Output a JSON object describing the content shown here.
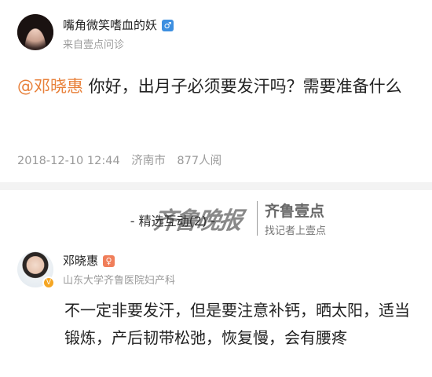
{
  "question": {
    "user_name": "嘴角微笑嗜血的妖",
    "gender_symbol": "♂",
    "source": "来自壹点问诊",
    "mention": "@邓晓惠",
    "text": " 你好，出月子必须要发汗吗？需要准备什么",
    "date": "2018-12-10 12:44",
    "location": "济南市",
    "views": "877人阅"
  },
  "featured": {
    "title": "- 精选互动(2) -"
  },
  "watermark": {
    "calligraphy": "齐鲁晚报",
    "brand": "齐鲁壹点",
    "slogan": "找记者上壹点"
  },
  "answer": {
    "doctor_name": "邓晓惠",
    "gender_symbol": "♀",
    "verified_symbol": "V",
    "hospital": "山东大学齐鲁医院妇产科",
    "text": "不一定非要发汗，但是要注意补钙，晒太阳，适当锻炼，产后韧带松弛，恢复慢，会有腰疼"
  },
  "colors": {
    "mention": "#e8803a",
    "male_badge": "#3d8fe0",
    "female_badge": "#f07e5a",
    "verified_badge": "#f5a623",
    "meta_text": "#9a9a9a"
  },
  "icons": [
    "user-avatar-icon",
    "male-gender-icon",
    "doctor-avatar-icon",
    "verified-badge-icon",
    "female-gender-icon"
  ]
}
